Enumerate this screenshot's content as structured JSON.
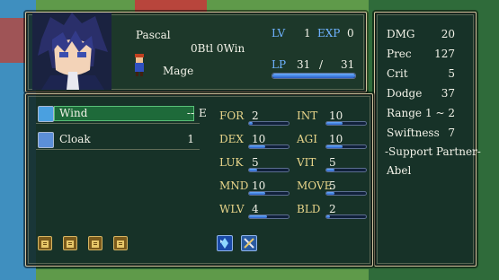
{
  "unit": {
    "name": "Pascal",
    "battles": "0Btl 0Win",
    "class": "Mage",
    "lv_label": "LV",
    "lv": "1",
    "exp_label": "EXP",
    "exp": "0",
    "lp_label": "LP",
    "lp_current": "31",
    "lp_sep": "/",
    "lp_max": "31",
    "lp_fraction": 1.0
  },
  "combat": {
    "rows": [
      {
        "label": "DMG",
        "value": "20"
      },
      {
        "label": "Prec",
        "value": "127"
      },
      {
        "label": "Crit",
        "value": "5"
      },
      {
        "label": "Dodge",
        "value": "37"
      },
      {
        "label": "Range",
        "value": "1 ~ 2"
      },
      {
        "label": "Swiftness",
        "value": "7"
      }
    ],
    "support_header": "-Support Partner-",
    "support_partner": "Abel"
  },
  "items": [
    {
      "name": "Wind",
      "uses": "--",
      "equipped": "E",
      "icon": "tome-icon",
      "color": "#4aa0e0",
      "selected": true
    },
    {
      "name": "Cloak",
      "uses": "1",
      "equipped": "",
      "icon": "cloak-icon",
      "color": "#5c8fd8",
      "selected": false
    }
  ],
  "stats": [
    {
      "label": "FOR",
      "value": "2",
      "fraction": 0.08
    },
    {
      "label": "INT",
      "value": "10",
      "fraction": 0.4
    },
    {
      "label": "DEX",
      "value": "10",
      "fraction": 0.4
    },
    {
      "label": "AGI",
      "value": "10",
      "fraction": 0.4
    },
    {
      "label": "LUK",
      "value": "5",
      "fraction": 0.2
    },
    {
      "label": "VIT",
      "value": "5",
      "fraction": 0.2
    },
    {
      "label": "MND",
      "value": "10",
      "fraction": 0.4
    },
    {
      "label": "MOVE",
      "value": "5",
      "fraction": 0.2
    },
    {
      "label": "WLV",
      "value": "4",
      "fraction": 0.45
    },
    {
      "label": "BLD",
      "value": "2",
      "fraction": 0.08
    }
  ],
  "skills": [
    {
      "icon": "skill-scroll-icon-1"
    },
    {
      "icon": "skill-scroll-icon-2"
    },
    {
      "icon": "skill-scroll-icon-3"
    },
    {
      "icon": "skill-scroll-icon-4"
    }
  ],
  "equip_types": [
    {
      "icon": "magic-crystal-icon"
    },
    {
      "icon": "crossed-swords-icon"
    }
  ],
  "colors": {
    "stat_label": "#e8d58a",
    "lv_label": "#6fb2ff",
    "selected_row": "#1e6a3a"
  }
}
